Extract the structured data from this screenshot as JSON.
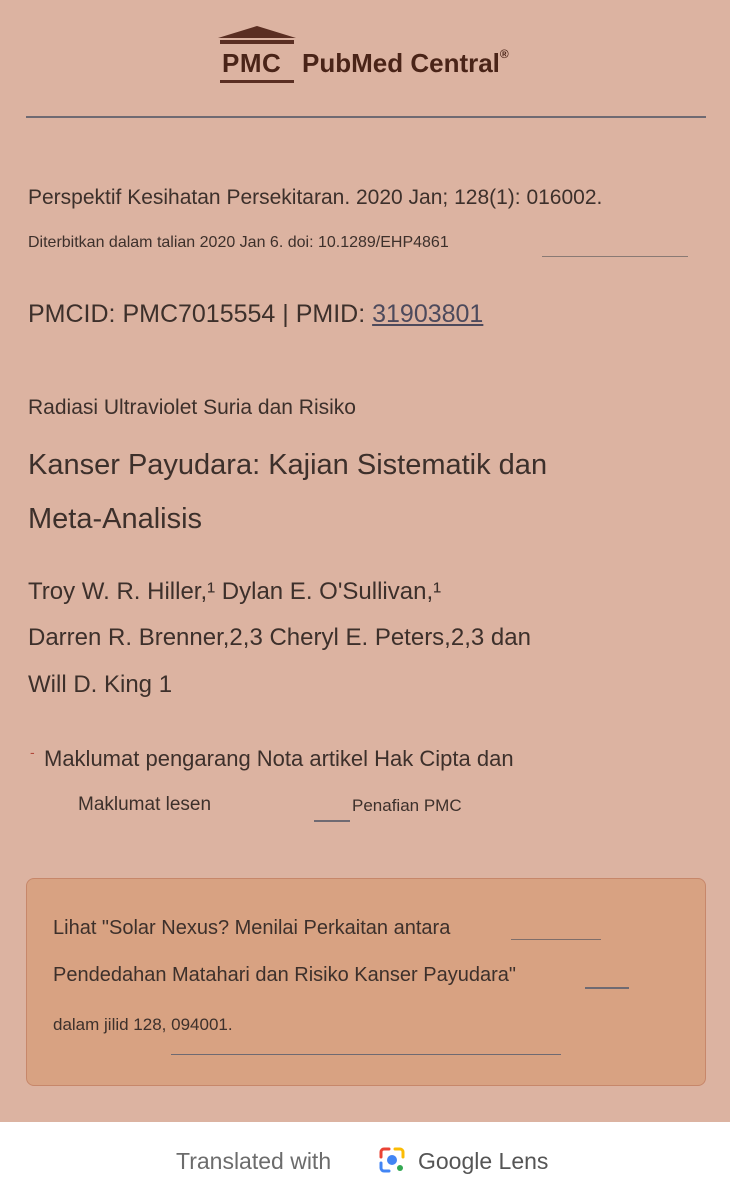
{
  "header": {
    "logo_abbr": "PMC",
    "logo_name": "PubMed Central",
    "logo_reg": "®"
  },
  "citation": {
    "journal_line": "Perspektif Kesihatan Persekitaran. 2020 Jan; 128(1): 016002.",
    "published_line": "Diterbitkan dalam talian 2020 Jan 6. doi: 10.1289/EHP4861",
    "ids_prefix": "PMCID: PMC7015554 | PMID: ",
    "pmid": "31903801"
  },
  "article": {
    "title_line1": "Radiasi Ultraviolet Suria dan Risiko",
    "title_line2": "Kanser Payudara: Kajian Sistematik dan",
    "title_line3": "Meta-Analisis",
    "authors_line1": "Troy W. R. Hiller,¹ Dylan E. O'Sullivan,¹",
    "authors_line2": "Darren R. Brenner,2,3 Cheryl E. Peters,2,3 dan",
    "authors_line3": "Will D. King 1"
  },
  "info": {
    "bullet": "-",
    "line1": "Maklumat pengarang Nota artikel Hak Cipta dan",
    "line2": "Maklumat lesen",
    "disclaimer": "Penafian PMC"
  },
  "notice": {
    "line1": "Lihat \"Solar Nexus? Menilai Perkaitan antara",
    "line2": "Pendedahan Matahari dan Risiko Kanser Payudara\"",
    "line3": "dalam jilid 128, 094001."
  },
  "footer": {
    "translated_with": "Translated with",
    "brand": "Google Lens"
  },
  "colors": {
    "background": "#dcb3a1",
    "notice_box": "#d8a282",
    "logo": "#4a2418"
  }
}
